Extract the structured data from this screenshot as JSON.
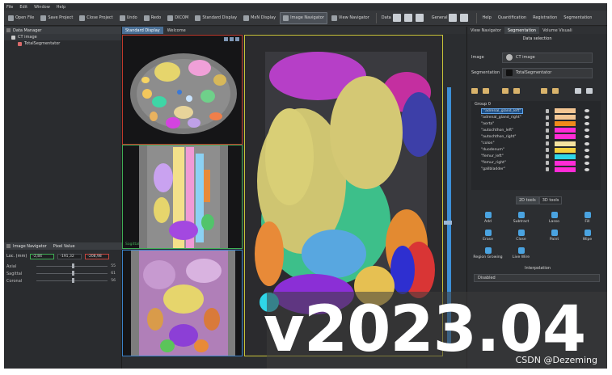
{
  "menu": [
    "File",
    "Edit",
    "Window",
    "Help"
  ],
  "toolbar": {
    "open_file": "Open File",
    "save_project": "Save Project",
    "close_project": "Close Project",
    "undo": "Undo",
    "redo": "Redo",
    "dicom": "DICOM",
    "standard_display": "Standard Display",
    "mxn_display": "MxN Display",
    "image_navigator": "Image Navigator",
    "view_navigator": "View Navigator",
    "data": "Data",
    "general": "General",
    "help": "Help",
    "quantification": "Quantification",
    "registration": "Registration",
    "segmentation": "Segmentation"
  },
  "data_manager": {
    "title": "Data Manager",
    "items": [
      {
        "label": "CT image"
      },
      {
        "label": "TotalSegmentator"
      }
    ]
  },
  "center": {
    "tabs": [
      "Standard Display",
      "Welcome"
    ],
    "sagittal_label": "Sagittal",
    "accent": "#4a6f95"
  },
  "image_navigator": {
    "title": "Image Navigator",
    "tab2": "Pixel Value",
    "loc_label": "Loc. (mm)",
    "loc_x": "-2,84",
    "loc_y": "-191,32",
    "loc_z": "-208,98",
    "sliders": [
      {
        "label": "Axial",
        "value": "55"
      },
      {
        "label": "Sagittal",
        "value": "61"
      },
      {
        "label": "Coronal",
        "value": "56"
      }
    ]
  },
  "right_panel": {
    "tabs": [
      "View Navigator",
      "Segmentation",
      "Volume Visuali"
    ],
    "section_title": "Data selection",
    "image_label": "Image",
    "image_value": "CT image",
    "seg_label": "Segmentation",
    "seg_value": "TotalSegmentator",
    "group": "Group 0",
    "segments": [
      {
        "name": "\"adrenal_gland_left\"",
        "color": "#f3c693",
        "selected": true
      },
      {
        "name": "\"adrenal_gland_right\"",
        "color": "#f3c693"
      },
      {
        "name": "\"aorta\"",
        "color": "#f08a1a"
      },
      {
        "name": "\"autochthon_left\"",
        "color": "#ff2bd6"
      },
      {
        "name": "\"autochthon_right\"",
        "color": "#ff2bd6"
      },
      {
        "name": "\"colon\"",
        "color": "#f5e3a0"
      },
      {
        "name": "\"duodenum\"",
        "color": "#f4d03f"
      },
      {
        "name": "\"femur_left\"",
        "color": "#2fd6e8"
      },
      {
        "name": "\"femur_right\"",
        "color": "#ff2bd6"
      },
      {
        "name": "\"gallbladder\"",
        "color": "#ff2bd6"
      }
    ],
    "tool_tabs": [
      "2D tools",
      "3D tools"
    ],
    "tools": [
      "Add",
      "Subtract",
      "Lasso",
      "Fill",
      "Erase",
      "Close",
      "Paint",
      "Wipe",
      "Region Growing",
      "Live Wire"
    ],
    "interpolation_title": "Interpolation",
    "interpolation_value": "Disabled"
  },
  "overlay": {
    "version": "v2023.04",
    "watermark": "CSDN @Dezeming"
  }
}
